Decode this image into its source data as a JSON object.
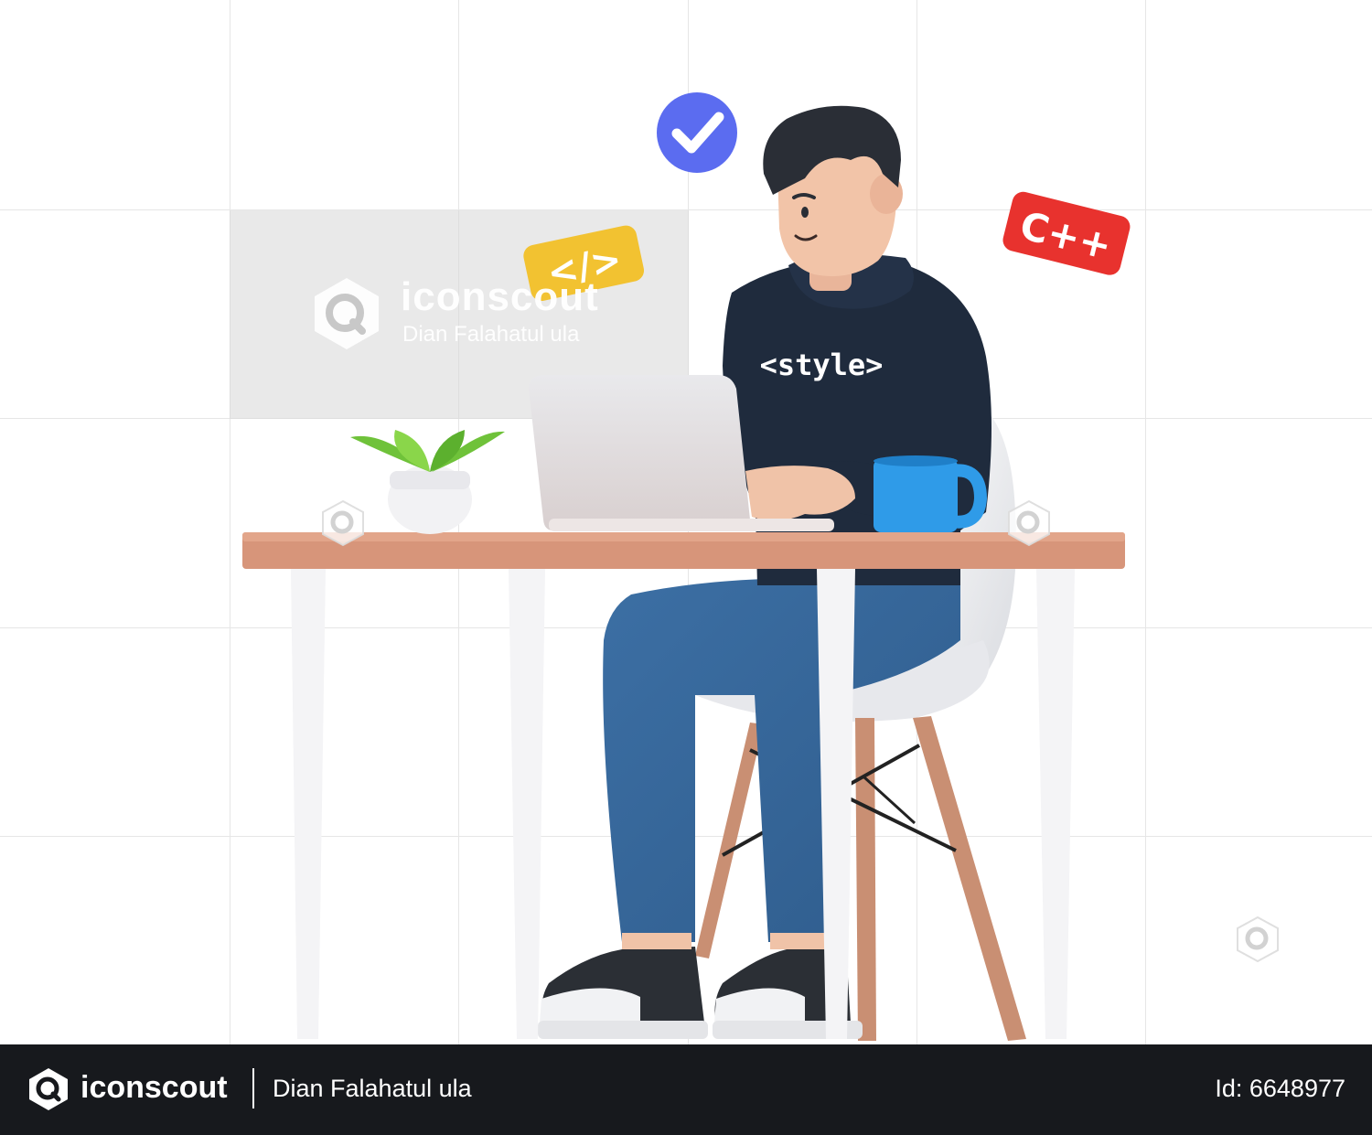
{
  "watermark": {
    "brand": "iconscout",
    "author": "Dian Falahatul ula"
  },
  "shirt_text": "<style>",
  "badges": {
    "code": "</>",
    "cpp": "C++",
    "check_icon": "check-icon"
  },
  "footer": {
    "brand": "iconscout",
    "author": "Dian Falahatul ula",
    "asset_id": "Id: 6648977"
  },
  "colors": {
    "footer_bg": "#17191d",
    "check_badge": "#5b6cf0",
    "code_badge": "#f2c231",
    "cpp_badge": "#e8322e",
    "hoodie": "#1f2b3d",
    "jeans": "#3a6a9e",
    "mug": "#2f9be8",
    "desk_top": "#d7957a"
  }
}
